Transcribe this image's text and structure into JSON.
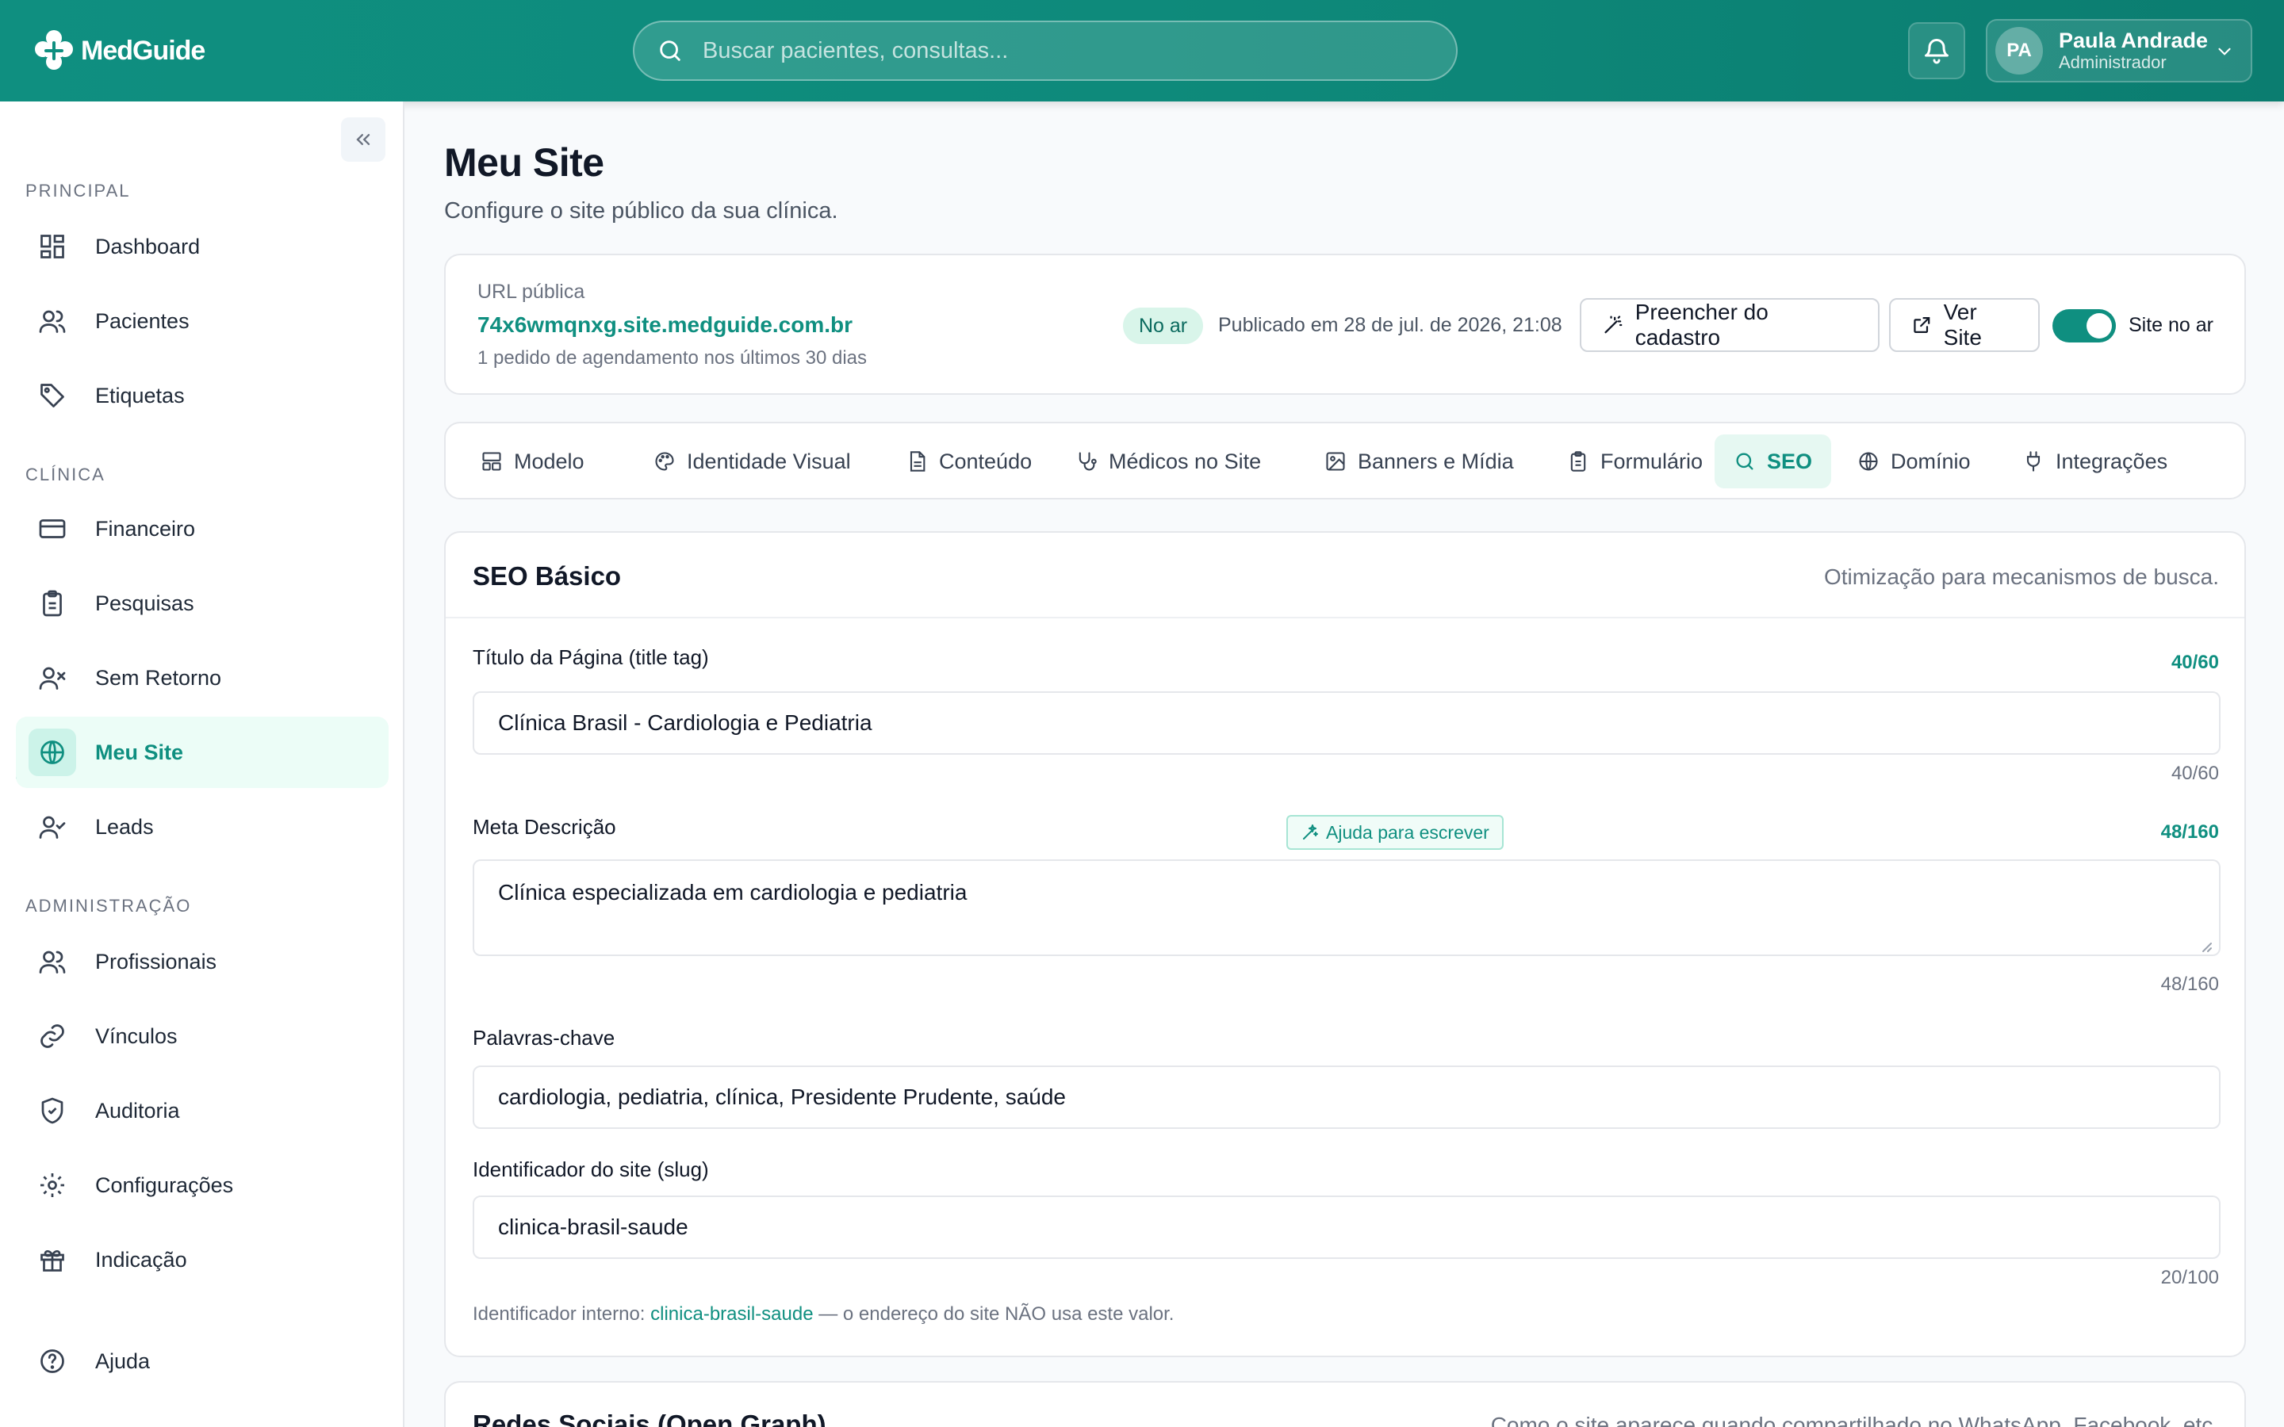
{
  "app": {
    "name": "MedGuide",
    "accent": "#0f8f80"
  },
  "topbar": {
    "search_placeholder": "Buscar pacientes, consultas...",
    "user": {
      "initials": "PA",
      "name": "Paula Andrade",
      "role": "Administrador"
    }
  },
  "sidebar": {
    "sections": [
      {
        "label": "PRINCIPAL"
      },
      {
        "label": "CLÍNICA"
      },
      {
        "label": "ADMINISTRAÇÃO"
      }
    ],
    "items": [
      {
        "label": "Dashboard",
        "icon": "dashboard-icon"
      },
      {
        "label": "Pacientes",
        "icon": "users-icon"
      },
      {
        "label": "Etiquetas",
        "icon": "tag-icon"
      },
      {
        "label": "Financeiro",
        "icon": "credit-card-icon"
      },
      {
        "label": "Pesquisas",
        "icon": "clipboard-icon"
      },
      {
        "label": "Sem Retorno",
        "icon": "user-x-icon"
      },
      {
        "label": "Meu Site",
        "icon": "globe-icon",
        "active": true
      },
      {
        "label": "Leads",
        "icon": "user-check-icon"
      },
      {
        "label": "Profissionais",
        "icon": "users-icon"
      },
      {
        "label": "Vínculos",
        "icon": "link-icon"
      },
      {
        "label": "Auditoria",
        "icon": "shield-icon"
      },
      {
        "label": "Configurações",
        "icon": "gear-icon"
      },
      {
        "label": "Indicação",
        "icon": "gift-icon"
      },
      {
        "label": "Ajuda",
        "icon": "help-circle-icon"
      }
    ]
  },
  "page": {
    "title": "Meu Site",
    "subtitle": "Configure o site público da sua clínica."
  },
  "url_card": {
    "label": "URL pública",
    "url": "74x6wmqnxg.site.medguide.com.br",
    "note": "1 pedido de agendamento nos últimos 30 dias",
    "status_badge": "No ar",
    "published": "Publicado em 28 de jul. de 2026, 21:08",
    "fill_button": "Preencher do cadastro",
    "view_button": "Ver Site",
    "toggle_label": "Site no ar",
    "toggle_on": true
  },
  "tabs": [
    {
      "label": "Modelo",
      "icon": "layout-icon"
    },
    {
      "label": "Identidade Visual",
      "icon": "palette-icon"
    },
    {
      "label": "Conteúdo",
      "icon": "file-text-icon"
    },
    {
      "label": "Médicos no Site",
      "icon": "stethoscope-icon"
    },
    {
      "label": "Banners e Mídia",
      "icon": "image-icon"
    },
    {
      "label": "Formulário",
      "icon": "clipboard-icon"
    },
    {
      "label": "SEO",
      "icon": "search-icon",
      "active": true
    },
    {
      "label": "Domínio",
      "icon": "globe-icon"
    },
    {
      "label": "Integrações",
      "icon": "plug-icon"
    }
  ],
  "seo": {
    "title": "SEO Básico",
    "description": "Otimização para mecanismos de busca.",
    "page_title": {
      "label": "Título da Página (title tag)",
      "value": "Clínica Brasil - Cardiologia e Pediatria",
      "counter": "40/60"
    },
    "meta": {
      "label": "Meta Descrição",
      "help_button": "Ajuda para escrever",
      "value": "Clínica especializada em cardiologia e pediatria",
      "counter": "48/160"
    },
    "keywords": {
      "label": "Palavras-chave",
      "value": "cardiologia, pediatria, clínica, Presidente Prudente, saúde"
    },
    "slug": {
      "label": "Identificador do site (slug)",
      "value": "clinica-brasil-saude",
      "counter": "20/100",
      "note_prefix": "Identificador interno: ",
      "note_code": "clinica-brasil-saude",
      "note_suffix": " — o endereço do site NÃO usa este valor."
    }
  },
  "og": {
    "title": "Redes Sociais (Open Graph)",
    "description": "Como o site aparece quando compartilhado no WhatsApp, Facebook, etc."
  }
}
